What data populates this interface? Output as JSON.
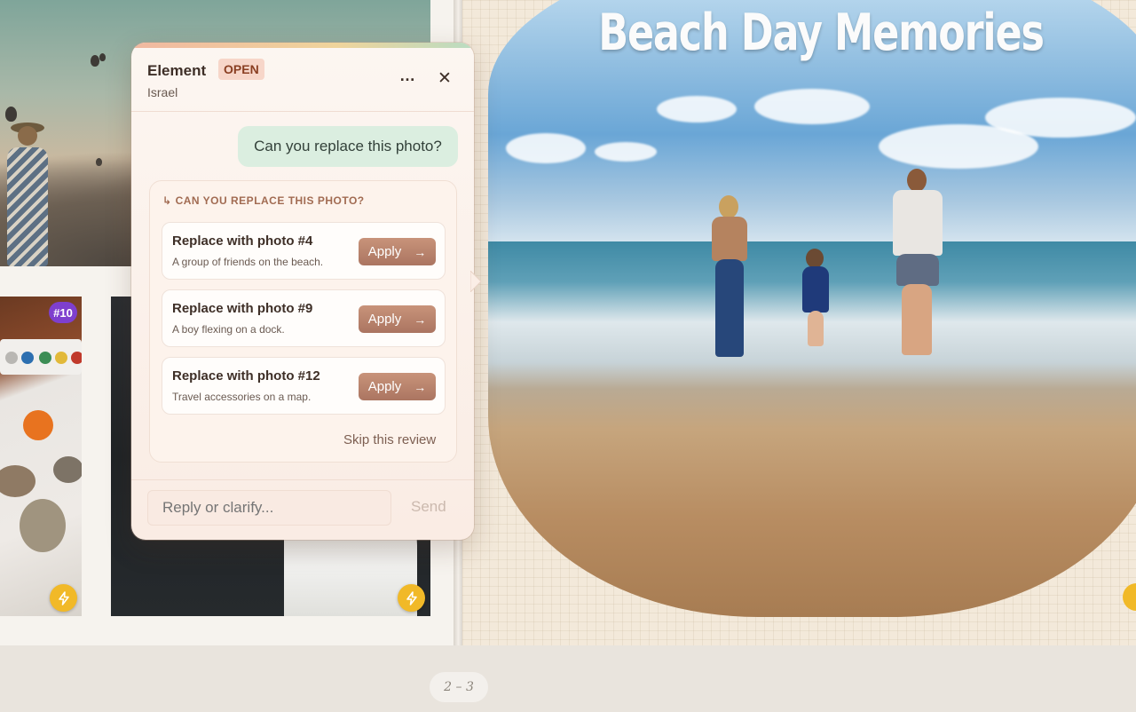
{
  "album": {
    "title": "Beach Day Memories",
    "page_indicator": "2 – 3",
    "photo_badge": "#10"
  },
  "panel": {
    "title": "Element",
    "status": "OPEN",
    "author": "Israel",
    "more_icon": "more-horizontal-icon",
    "close_icon": "close-icon",
    "user_message": "Can you replace this photo?",
    "suggestion_header": "CAN YOU REPLACE THIS PHOTO?",
    "suggestions": [
      {
        "title": "Replace with photo #4",
        "description": "A group of friends on the beach.",
        "action": "Apply"
      },
      {
        "title": "Replace with photo #9",
        "description": "A boy flexing on a dock.",
        "action": "Apply"
      },
      {
        "title": "Replace with photo #12",
        "description": "Travel accessories on a map.",
        "action": "Apply"
      }
    ],
    "skip_label": "Skip this review",
    "reply_placeholder": "Reply or clarify...",
    "send_label": "Send"
  },
  "colors": {
    "accent": "#ab7561",
    "status_badge": "#f7d6c9",
    "user_bubble": "#dbeee0",
    "photo_badge": "#7e3fce",
    "smart_badge": "#f1b928"
  }
}
